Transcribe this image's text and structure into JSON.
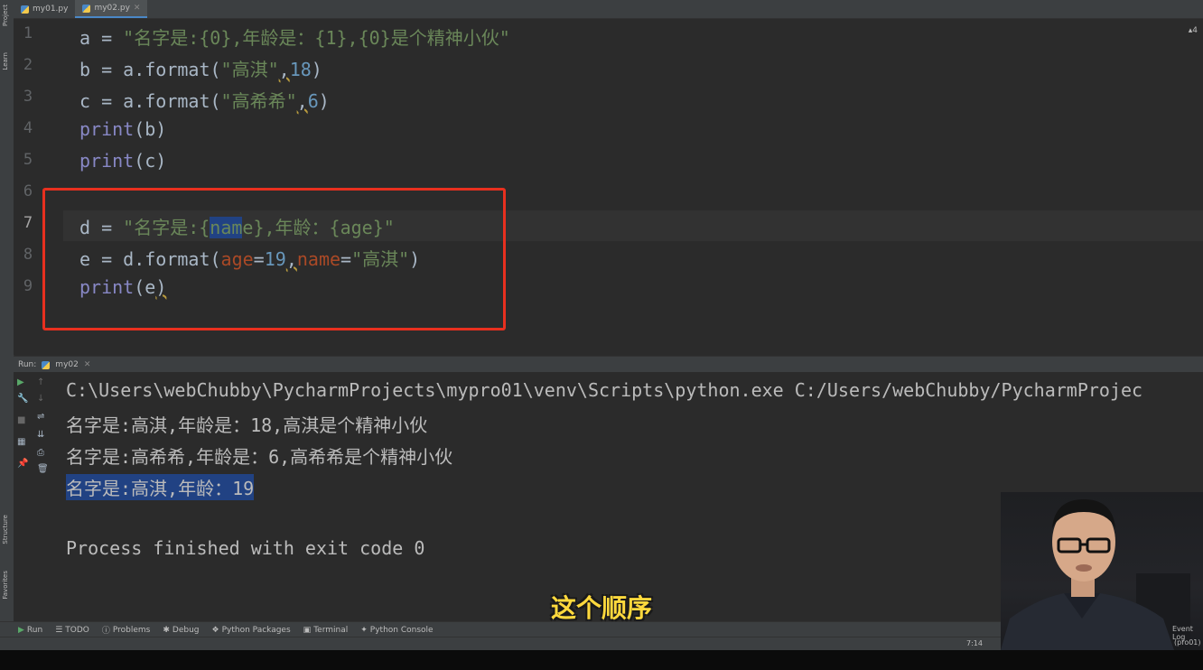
{
  "left_strip": {
    "project": "Project",
    "learn": "Learn",
    "structure": "Structure",
    "favorites": "Favorites"
  },
  "tabs": [
    {
      "label": "my01.py"
    },
    {
      "label": "my02.py",
      "active": true
    }
  ],
  "editor": {
    "line_numbers": [
      "1",
      "2",
      "3",
      "4",
      "5",
      "6",
      "7",
      "8",
      "9"
    ],
    "current_line": "7",
    "warning_count": "4",
    "code": {
      "l1": {
        "a": "a",
        "eq": " = ",
        "str": "\"名字是:{0},年龄是：{1},{0}是个精神小伙\""
      },
      "l2": {
        "pre": "b = a.format(",
        "s": "\"高淇\"",
        "comma": ",",
        "n": "18",
        "post": ")"
      },
      "l3": {
        "pre": "c = a.format(",
        "s": "\"高希希\"",
        "comma": ",",
        "n": "6",
        "post": ")"
      },
      "l4": {
        "fn": "print",
        "args": "(b)"
      },
      "l5": {
        "fn": "print",
        "args": "(c)"
      },
      "l7": {
        "pre": "d = ",
        "s1": "\"名字是:{",
        "s2": "nam",
        "s3": "e},年龄：{age}\""
      },
      "l8": {
        "pre": "e = d.format(",
        "k1": "age",
        "eq1": "=",
        "n": "19",
        "comma": ",",
        "k2": "name",
        "eq2": "=",
        "s": "\"高淇\"",
        "post": ")"
      },
      "l9": {
        "fn": "print",
        "args": "(e",
        "close": ")"
      }
    }
  },
  "run_panel": {
    "label": "Run:",
    "config": "my02",
    "output": [
      "C:\\Users\\webChubby\\PycharmProjects\\mypro01\\venv\\Scripts\\python.exe C:/Users/webChubby/PycharmProjec",
      "名字是:高淇,年龄是：18,高淇是个精神小伙",
      "名字是:高希希,年龄是：6,高希希是个精神小伙",
      "名字是:高淇,年龄：19",
      "",
      "Process finished with exit code 0"
    ]
  },
  "bottom_tabs": [
    "Run",
    "TODO",
    "Problems",
    "Debug",
    "Python Packages",
    "Terminal",
    "Python Console"
  ],
  "status": {
    "event_log": "Event Log",
    "position": "7:14",
    "interpreter": "(pro01)"
  },
  "subtitle": "这个顺序",
  "colors": {
    "background": "#2b2b2b",
    "highlight_box": "#e8301f",
    "selection": "#214283",
    "subtitle": "#ffd93d"
  }
}
